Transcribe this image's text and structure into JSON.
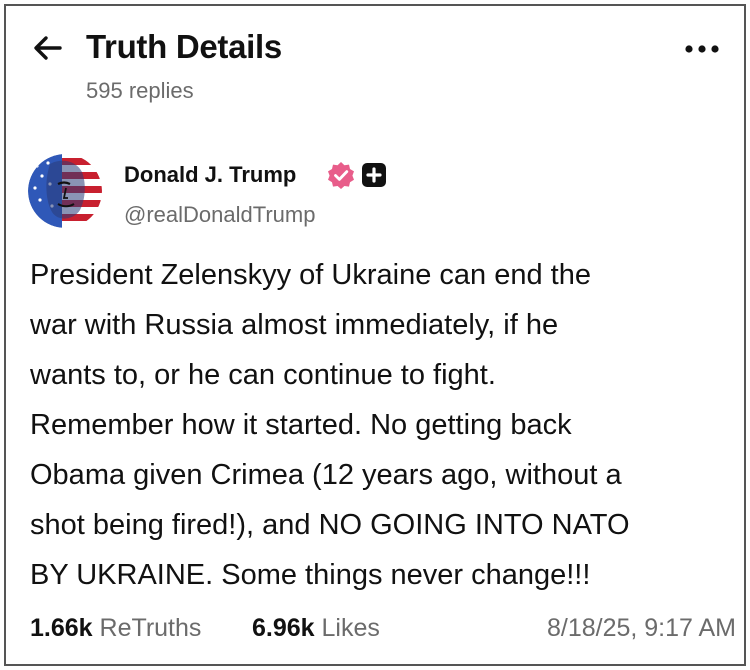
{
  "header": {
    "title": "Truth Details",
    "reply_count": "595 replies",
    "back_icon": "arrow-left-icon",
    "more_icon": "more-horizontal-icon"
  },
  "post": {
    "author": {
      "name": "Donald J. Trump",
      "handle": "@realDonaldTrump",
      "verified_icon": "verified-badge-icon",
      "verified_color": "#e85d8a",
      "plus_icon": "plus-badge-icon"
    },
    "body_lines": [
      "President Zelenskyy of Ukraine can end the",
      "war with Russia almost immediately, if he",
      "wants to, or he can continue to fight.",
      "Remember how it started. No getting back",
      "Obama given Crimea (12 years ago, without a",
      "shot being fired!), and NO GOING INTO NATO",
      "BY UKRAINE. Some things never change!!!"
    ],
    "stats": {
      "retruths_count": "1.66k",
      "retruths_label": "ReTruths",
      "likes_count": "6.96k",
      "likes_label": "Likes"
    },
    "timestamp": "8/18/25, 9:17 AM"
  }
}
